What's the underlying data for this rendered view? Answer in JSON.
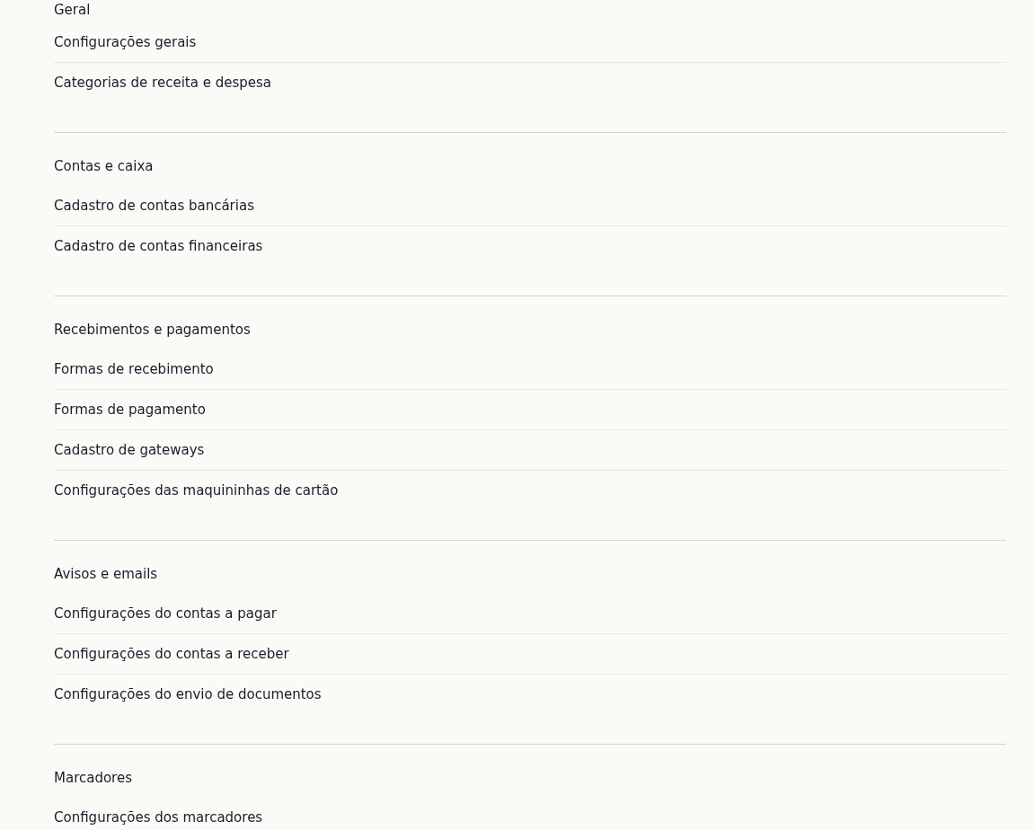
{
  "sections": [
    {
      "title": "Geral",
      "items": [
        "Configurações gerais",
        "Categorias de receita e despesa"
      ]
    },
    {
      "title": "Contas e caixa",
      "items": [
        "Cadastro de contas bancárias",
        "Cadastro de contas financeiras"
      ]
    },
    {
      "title": "Recebimentos e pagamentos",
      "items": [
        "Formas de recebimento",
        "Formas de pagamento",
        "Cadastro de gateways",
        "Configurações das maquininhas de cartão"
      ]
    },
    {
      "title": "Avisos e emails",
      "items": [
        "Configurações do contas a pagar",
        "Configurações do contas a receber",
        "Configurações do envio de documentos"
      ]
    },
    {
      "title": "Marcadores",
      "items": [
        "Configurações dos marcadores"
      ]
    }
  ]
}
